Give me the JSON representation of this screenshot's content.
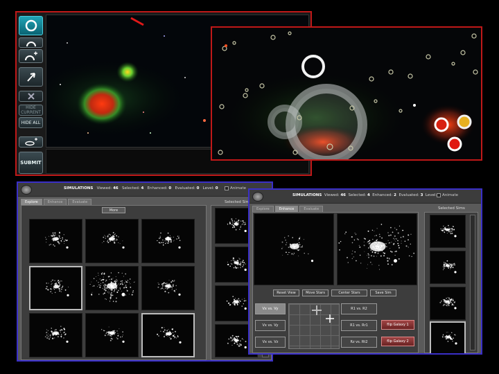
{
  "toolbar": {
    "hide_current": "HIDE CURRENT",
    "hide_all": "HIDE ALL",
    "submit": "SUBMIT"
  },
  "app1": {
    "header": {
      "title": "SIMULATIONS",
      "viewed_label": "Viewed:",
      "viewed": "46",
      "selected_label": "Selected:",
      "selected": "4",
      "enhanced_label": "Enhanced:",
      "enhanced": "0",
      "evaluated_label": "Evaluated:",
      "evaluated": "0",
      "level_label": "Level:",
      "level": "0",
      "animate": "Animate"
    },
    "tabs": [
      "Explore",
      "Enhance",
      "Evaluate"
    ],
    "more_button": "More",
    "selected_title": "Selected Sim"
  },
  "app2": {
    "header": {
      "title": "SIMULATIONS",
      "viewed_label": "Viewed:",
      "viewed": "46",
      "selected_label": "Selected:",
      "selected": "4",
      "enhanced_label": "Enhanced:",
      "enhanced": "2",
      "evaluated_label": "Evaluated:",
      "evaluated": "3",
      "level_label": "Level:",
      "level": "5",
      "animate": "Animate"
    },
    "tabs": [
      "Explore",
      "Enhance",
      "Evaluate"
    ],
    "buttons": [
      "Reset View",
      "Move Stars",
      "Center Stars",
      "Save Sim"
    ],
    "projections_left": [
      "Vx vs. Vy",
      "Vx vs. Vy",
      "Vx vs. Vz"
    ],
    "projections_right": [
      "R1 vs. R2",
      "R1 vs. Rr1",
      "Rz vs. Rt2"
    ],
    "flip_buttons": [
      "flip Galaxy 1",
      "flip Galaxy 2"
    ],
    "selected_title": "Selected Sims"
  },
  "colors": {
    "red_frame": "#c01818",
    "blue_frame": "#3a2fc8",
    "accent": "#1fa4b6"
  }
}
